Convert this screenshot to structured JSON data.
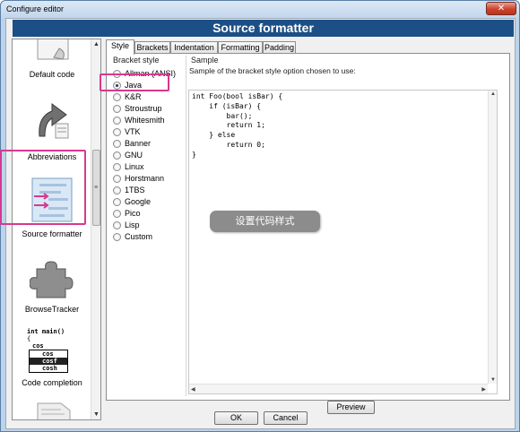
{
  "window": {
    "title": "Configure editor",
    "close_symbol": "✕"
  },
  "banner": {
    "title": "Source formatter"
  },
  "categories": [
    {
      "label": "Default code"
    },
    {
      "label": "Abbreviations"
    },
    {
      "label": "Source formatter"
    },
    {
      "label": "BrowseTracker"
    },
    {
      "label": "Code completion",
      "snippet": [
        "int main()",
        "{",
        "cos",
        "cos",
        "cosf",
        "cosh"
      ]
    }
  ],
  "tabs": [
    "Style",
    "Brackets",
    "Indentation",
    "Formatting",
    "Padding"
  ],
  "bracket_style": {
    "group_title": "Bracket style",
    "selected": "Java",
    "options": [
      "Allman (ANSI)",
      "Java",
      "K&R",
      "Stroustrup",
      "Whitesmith",
      "VTK",
      "Banner",
      "GNU",
      "Linux",
      "Horstmann",
      "1TBS",
      "Google",
      "Pico",
      "Lisp",
      "Custom"
    ]
  },
  "sample": {
    "group_title": "Sample",
    "description": "Sample of the bracket style option chosen to use:",
    "code": "int Foo(bool isBar) {\n    if (isBar) {\n        bar();\n        return 1;\n    } else\n        return 0;\n}"
  },
  "buttons": {
    "preview": "Preview",
    "ok": "OK",
    "cancel": "Cancel"
  },
  "annotation": {
    "text": "设置代码样式"
  },
  "colors": {
    "banner": "#1c4f86",
    "highlight": "#d6398f",
    "callout": "#8c8c8c"
  }
}
